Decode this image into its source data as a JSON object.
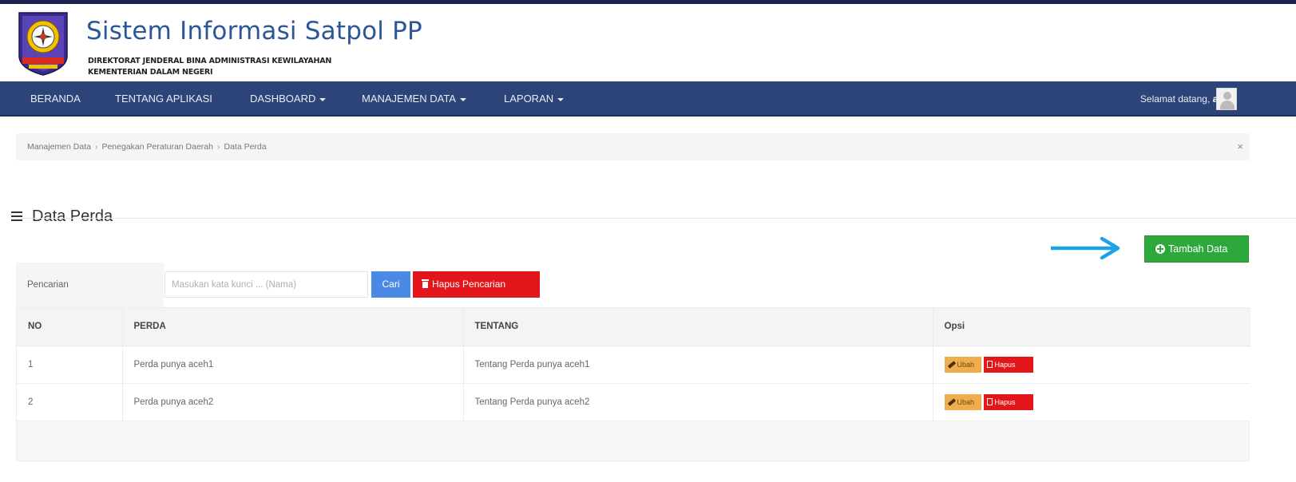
{
  "header": {
    "title": "Sistem Informasi Satpol PP",
    "subtitle_line1": "DIREKTORAT JENDERAL BINA ADMINISTRASI KEWILAYAHAN",
    "subtitle_line2": "KEMENTERIAN DALAM NEGERI"
  },
  "nav": {
    "items": [
      {
        "label": "BERANDA"
      },
      {
        "label": "TENTANG APLIKASI"
      },
      {
        "label": "DASHBOARD"
      },
      {
        "label": "MANAJEMEN DATA"
      },
      {
        "label": "LAPORAN"
      }
    ],
    "welcome_text": "Selamat datang,",
    "username": "aceh"
  },
  "breadcrumb": {
    "items": [
      "Manajemen Data",
      "Penegakan Peraturan Daerah",
      "Data Perda"
    ],
    "separator": "›",
    "close": "×"
  },
  "page": {
    "title": "Data Perda",
    "add_button": "Tambah Data"
  },
  "search": {
    "label": "Pencarian",
    "placeholder": "Masukan kata kunci ... (Nama)",
    "search_button": "Cari",
    "clear_button": "Hapus Pencarian"
  },
  "table": {
    "columns": [
      "NO",
      "PERDA",
      "TENTANG",
      "Opsi"
    ],
    "rows": [
      {
        "no": "1",
        "perda": "Perda punya aceh1",
        "tentang": "Tentang Perda punya aceh1"
      },
      {
        "no": "2",
        "perda": "Perda punya aceh2",
        "tentang": "Tentang Perda punya aceh2"
      }
    ],
    "edit_label": "Ubah",
    "delete_label": "Hapus"
  },
  "colors": {
    "navbar": "#2c4478",
    "title": "#2b5797",
    "add_button": "#2da83a",
    "search_button": "#4a8ae5",
    "danger": "#e3161b",
    "edit_button": "#f0ad4e",
    "arrow": "#1ba3e8"
  }
}
